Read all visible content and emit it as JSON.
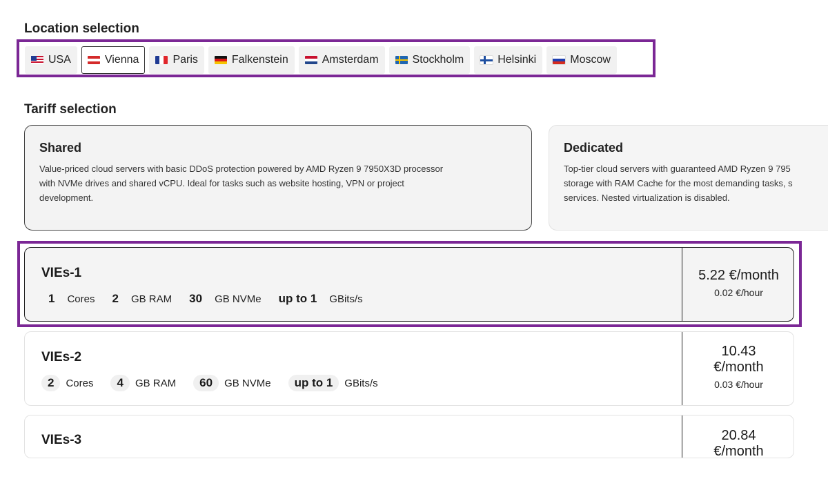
{
  "location": {
    "title": "Location selection",
    "items": [
      {
        "label": "USA",
        "flag": "usa"
      },
      {
        "label": "Vienna",
        "flag": "at",
        "active": true
      },
      {
        "label": "Paris",
        "flag": "fr"
      },
      {
        "label": "Falkenstein",
        "flag": "de"
      },
      {
        "label": "Amsterdam",
        "flag": "nl"
      },
      {
        "label": "Stockholm",
        "flag": "se"
      },
      {
        "label": "Helsinki",
        "flag": "fi"
      },
      {
        "label": "Moscow",
        "flag": "ru"
      }
    ]
  },
  "tariff": {
    "title": "Tariff selection",
    "shared": {
      "name": "Shared",
      "desc1": "Value-priced cloud servers with basic DDoS protection powered by AMD Ryzen 9 7950X3D processor",
      "desc2": "with NVMe drives and shared vCPU. Ideal for tasks such as website hosting, VPN or project",
      "desc3": "development."
    },
    "dedicated": {
      "name": "Dedicated",
      "desc1": "Top-tier cloud servers with guaranteed AMD Ryzen 9 795",
      "desc2": "storage with RAM Cache for the most demanding tasks, s",
      "desc3": "services. Nested virtualization is disabled."
    }
  },
  "plans": [
    {
      "name": "VIEs-1",
      "cores": "1",
      "cores_unit": "Cores",
      "ram": "2",
      "ram_unit": "GB RAM",
      "disk": "30",
      "disk_unit": "GB NVMe",
      "net": "up to 1",
      "net_unit": "GBits/s",
      "price_month": "5.22 €/month",
      "price_hour": "0.02 €/hour"
    },
    {
      "name": "VIEs-2",
      "cores": "2",
      "cores_unit": "Cores",
      "ram": "4",
      "ram_unit": "GB RAM",
      "disk": "60",
      "disk_unit": "GB NVMe",
      "net": "up to 1",
      "net_unit": "GBits/s",
      "price_month_a": "10.43",
      "price_month_b": "€/month",
      "price_hour": "0.03 €/hour"
    },
    {
      "name": "VIEs-3",
      "price_month_a": "20.84",
      "price_month_b": "€/month"
    }
  ],
  "colors": {
    "highlight": "#7b2795"
  }
}
